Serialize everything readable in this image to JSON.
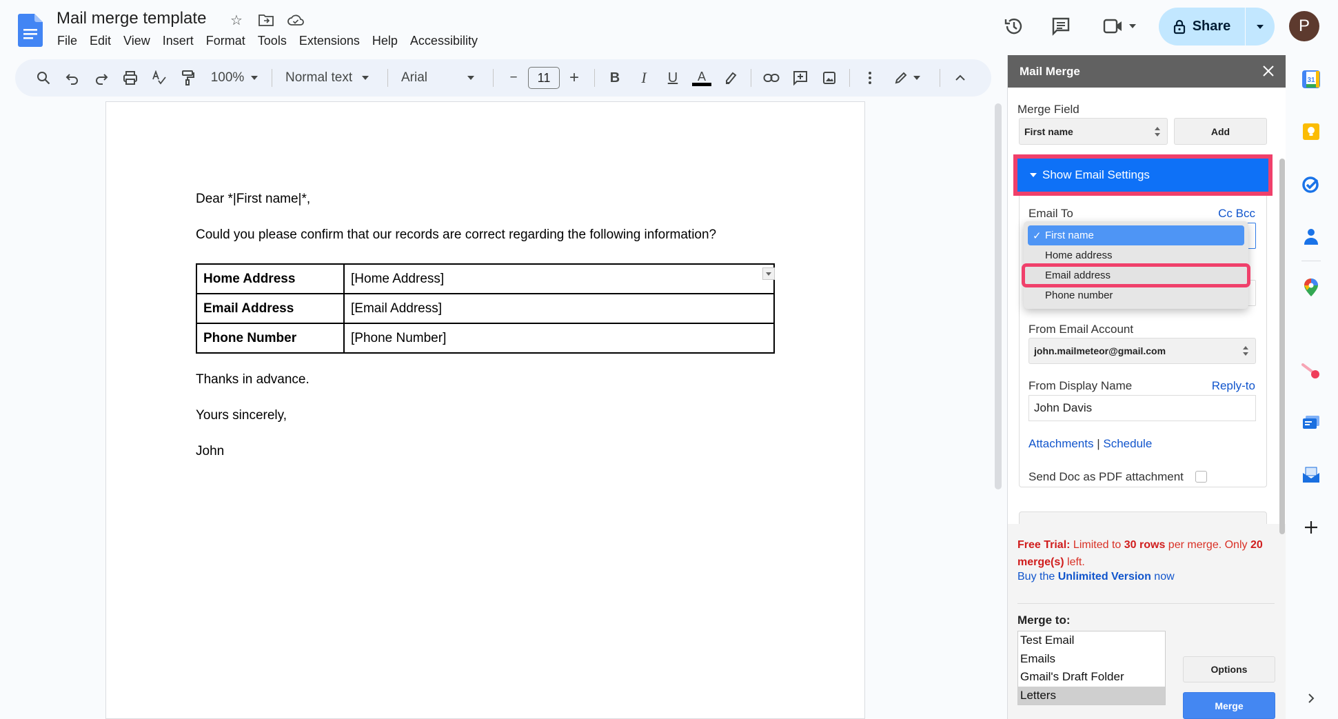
{
  "app": {
    "doc_title": "Mail merge template",
    "menu": [
      "File",
      "Edit",
      "View",
      "Insert",
      "Format",
      "Tools",
      "Extensions",
      "Help",
      "Accessibility"
    ],
    "share_label": "Share",
    "avatar_initial": "P",
    "brand_color": "#4285f4"
  },
  "toolbar": {
    "zoom": "100%",
    "style": "Normal text",
    "font": "Arial",
    "font_size": "11",
    "minus": "−",
    "plus": "+",
    "bold": "B",
    "italic": "I",
    "underline": "U",
    "text_color": "A"
  },
  "document": {
    "greeting": "Dear *|First name|*,",
    "intro": "Could you please confirm that our records are correct regarding the following information?",
    "table": [
      {
        "label": "Home Address",
        "value": "[Home Address]"
      },
      {
        "label": "Email Address",
        "value": "[Email Address]"
      },
      {
        "label": "Phone Number",
        "value": "[Phone Number]"
      }
    ],
    "thanks": "Thanks in advance.",
    "closing": "Yours sincerely,",
    "signature": "John"
  },
  "sidebar": {
    "title": "Mail Merge",
    "merge_field_label": "Merge Field",
    "merge_field_value": "First name",
    "add_label": "Add",
    "show_email_settings": "Show Email Settings",
    "email_to_label": "Email To",
    "cc_bcc_label": "Cc Bcc",
    "email_to_options": [
      {
        "label": "First name",
        "selected": true
      },
      {
        "label": "Home address",
        "selected": false
      },
      {
        "label": "Email address",
        "selected": false,
        "highlighted": true
      },
      {
        "label": "Phone number",
        "selected": false
      }
    ],
    "checkmark": "✓",
    "from_account_label": "From Email Account",
    "from_account_value": "john.mailmeteor@gmail.com",
    "display_name_label": "From Display Name",
    "reply_to_label": "Reply-to",
    "display_name_value": "John Davis",
    "attachments_label": "Attachments",
    "link_sep": "|",
    "schedule_label": "Schedule",
    "send_pdf_label": "Send Doc as PDF attachment",
    "send_pdf_checked": false,
    "trial": {
      "prefix": "Free Trial:",
      "text1": " Limited to ",
      "rows": "30 rows",
      "text2": " per merge. Only ",
      "merges": "20 merge(s)",
      "text3": " left."
    },
    "buy": {
      "prefix": "Buy the ",
      "bold": "Unlimited Version",
      "suffix": " now"
    },
    "merge_to_label": "Merge to:",
    "merge_to_options": [
      {
        "label": "Test Email",
        "selected": false
      },
      {
        "label": "Emails",
        "selected": false
      },
      {
        "label": "Gmail's Draft Folder",
        "selected": false
      },
      {
        "label": "Letters",
        "selected": true
      }
    ],
    "options_label": "Options",
    "merge_label": "Merge",
    "accent_color": "#0e71f7",
    "highlight_color": "#f0406b"
  },
  "right_rail": {
    "icons": [
      "calendar-icon",
      "keep-icon",
      "tasks-icon",
      "contacts-icon",
      "maps-icon",
      "mailmeteor-icon",
      "addon-card-icon",
      "addon-mail-icon",
      "add-icon"
    ],
    "calendar_day": "31"
  }
}
